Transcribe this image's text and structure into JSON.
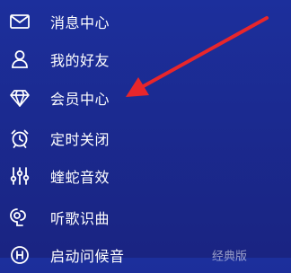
{
  "menu": {
    "items": [
      {
        "label": "消息中心",
        "icon": "mail-icon"
      },
      {
        "label": "我的好友",
        "icon": "friends-icon"
      },
      {
        "label": "会员中心",
        "icon": "diamond-icon"
      },
      {
        "label": "定时关闭",
        "icon": "alarm-clock-icon"
      },
      {
        "label": "蝰蛇音效",
        "icon": "equalizer-icon"
      },
      {
        "label": "听歌识曲",
        "icon": "music-recognition-icon"
      },
      {
        "label": "启动问候音",
        "icon": "greeting-icon",
        "tag": "经典版"
      }
    ]
  },
  "annotation": {
    "arrow_color": "#e8262b"
  },
  "colors": {
    "background": "#1b2a90",
    "text": "#ffffff"
  }
}
